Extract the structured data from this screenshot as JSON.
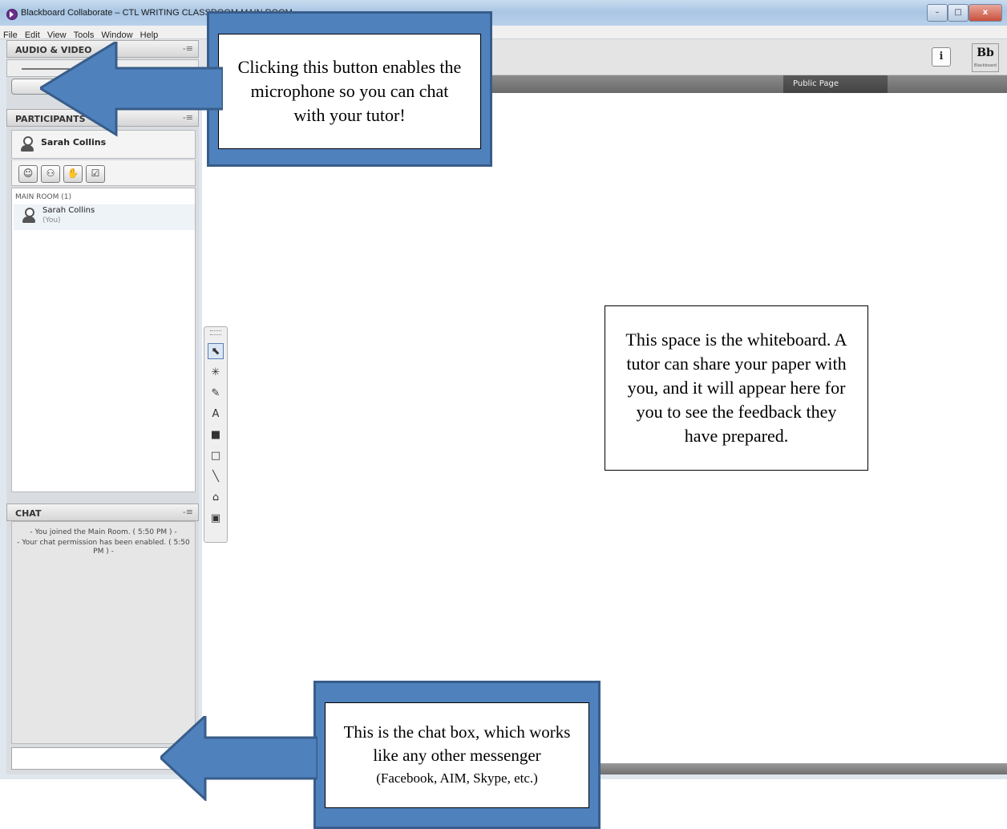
{
  "window": {
    "title": "Blackboard Collaborate – CTL WRITING CLASSROOM MAIN ROOM",
    "buttons": {
      "minimize": "–",
      "maximize": "□",
      "close": "x"
    }
  },
  "menubar": {
    "items": [
      "File",
      "Edit",
      "View",
      "Tools",
      "Window",
      "Help"
    ]
  },
  "audio_video": {
    "title": "AUDIO & VIDEO",
    "menu_icon": "-≡"
  },
  "participants": {
    "title": "PARTICIPANTS",
    "menu_icon": "-≡",
    "me": "Sarah Collins",
    "room_label": "MAIN ROOM (1)",
    "list": [
      {
        "name": "Sarah Collins",
        "sub": "(You)"
      }
    ]
  },
  "chat": {
    "title": "CHAT",
    "menu_icon": "-≡",
    "messages": [
      "- You joined the Main Room. ( 5:50 PM ) -",
      "- Your chat permission has been enabled. ( 5:50 PM ) -"
    ]
  },
  "content": {
    "page_tab": "Public Page",
    "info_btn": "i",
    "logo": {
      "text": "Bb",
      "sub": "Blackboard"
    }
  },
  "callouts": {
    "mic": "Clicking this button enables the microphone so you can chat with your tutor!",
    "whiteboard": "This space is the whiteboard. A tutor can share your paper with you, and it will appear here for you to see the feedback they have prepared.",
    "chat_line1": "This is the chat box, which works like any other messenger",
    "chat_line2": "(Facebook, AIM, Skype, etc.)"
  },
  "colors": {
    "callout_blue": "#4f81bd",
    "callout_border": "#385d8a"
  }
}
